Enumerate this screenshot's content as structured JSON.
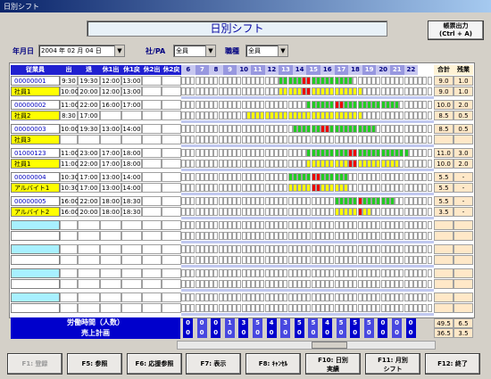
{
  "window": {
    "title": "日別シフト"
  },
  "header": {
    "title": "日別シフト",
    "print_btn_1": "帳票出力",
    "print_btn_2": "(Ctrl + A)"
  },
  "filters": {
    "date_label": "年月日",
    "date_value": "2004 年 02 月 04 日",
    "type_label": "社/PA",
    "type_value": "全員",
    "job_label": "職種",
    "job_value": "全員"
  },
  "columns": {
    "staff": "従業員",
    "in": "出",
    "out": "退",
    "rest1_out": "休1出",
    "rest1_in": "休1戻",
    "rest2_out": "休2出",
    "rest2_in": "休2戻",
    "total": "合計",
    "overtime": "残業"
  },
  "hours": [
    "6",
    "7",
    "8",
    "9",
    "10",
    "11",
    "12",
    "13",
    "14",
    "15",
    "16",
    "17",
    "18",
    "19",
    "20",
    "21",
    "22"
  ],
  "staff_rows": [
    {
      "id": "00000001",
      "name": "社員1",
      "in1": "9:30",
      "out1": "19:30",
      "r1o": "12:00",
      "r1i": "13:00",
      "in2": "10:00",
      "out2": "20:00",
      "r2o": "12:00",
      "r2i": "13:00",
      "t1": "9.0",
      "o1": "1.0",
      "t2": "9.0",
      "o2": "1.0"
    },
    {
      "id": "00000002",
      "name": "社員2",
      "in1": "11:00",
      "out1": "22:00",
      "r1o": "16:00",
      "r1i": "17:00",
      "in2": "8:30",
      "out2": "17:00",
      "r2o": "",
      "r2i": "",
      "t1": "10.0",
      "o1": "2.0",
      "t2": "8.5",
      "o2": "0.5"
    },
    {
      "id": "00000003",
      "name": "社員3",
      "in1": "10:00",
      "out1": "19:30",
      "r1o": "13:00",
      "r1i": "14:00",
      "in2": "",
      "out2": "",
      "r2o": "",
      "r2i": "",
      "t1": "8.5",
      "o1": "0.5",
      "t2": "",
      "o2": ""
    },
    {
      "id": "01000123",
      "name": "社員1",
      "in1": "11:00",
      "out1": "23:00",
      "r1o": "17:00",
      "r1i": "18:00",
      "in2": "11:00",
      "out2": "22:00",
      "r2o": "17:00",
      "r2i": "18:00",
      "t1": "11.0",
      "o1": "3.0",
      "t2": "10.0",
      "o2": "2.0"
    },
    {
      "id": "00000004",
      "name": "アルバイト1",
      "in1": "10:30",
      "out1": "17:00",
      "r1o": "13:00",
      "r1i": "14:00",
      "in2": "10:30",
      "out2": "17:00",
      "r2o": "13:00",
      "r2i": "14:00",
      "t1": "5.5",
      "o1": "-",
      "t2": "5.5",
      "o2": "-"
    },
    {
      "id": "00000005",
      "name": "アルバイト2",
      "in1": "16:00",
      "out1": "22:00",
      "r1o": "18:00",
      "r1i": "18:30",
      "in2": "16:00",
      "out2": "20:00",
      "r2o": "18:00",
      "r2i": "18:30",
      "t1": "5.5",
      "o1": "-",
      "t2": "3.5",
      "o2": "-"
    }
  ],
  "footer": {
    "labor_label": "労働時間（人数）",
    "sales_label": "売上計画",
    "labor_counts": [
      "0",
      "0",
      "0",
      "1",
      "3",
      "5",
      "4",
      "3",
      "5",
      "5",
      "4",
      "5",
      "5",
      "5",
      "0",
      "0",
      "0"
    ],
    "sales_counts": [
      "0",
      "0",
      "0",
      "0",
      "0",
      "0",
      "0",
      "0",
      "0",
      "0",
      "0",
      "0",
      "0",
      "0",
      "0",
      "0",
      "0"
    ],
    "total_top": "49.5",
    "ot_top": "6.5",
    "total_bot": "36.5",
    "ot_bot": "3.5"
  },
  "buttons": {
    "f1": "F1: 登録",
    "f5": "F5: 参照",
    "f6": "F6: 応援参照",
    "f7": "F7: 表示",
    "f8": "F8: ｷｬﾝｾﾙ",
    "f10a": "F10: 日別",
    "f10b": "実績",
    "f11a": "F11: 月別",
    "f11b": "シフト",
    "f12": "F12: 終了"
  }
}
